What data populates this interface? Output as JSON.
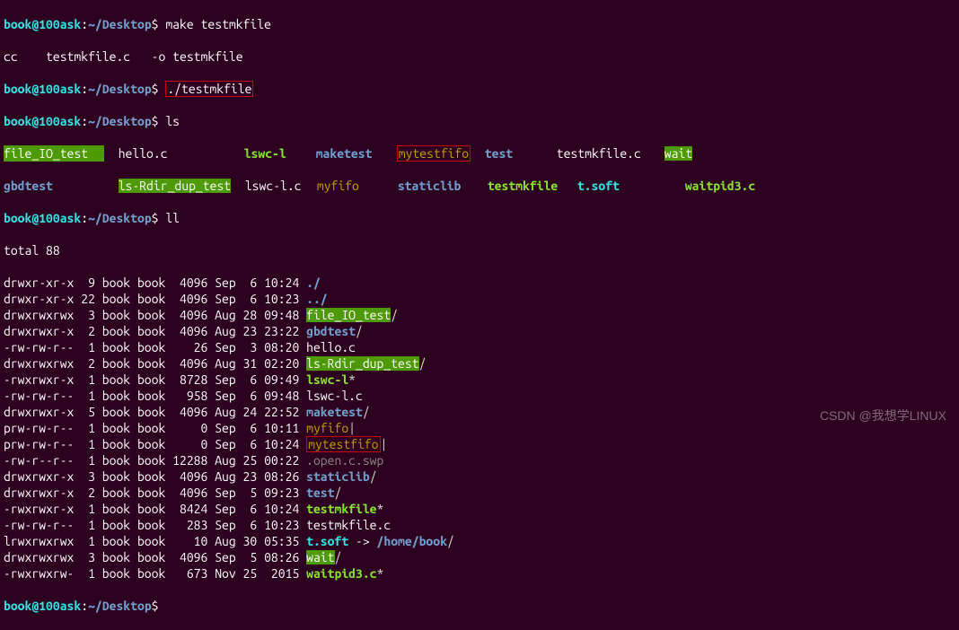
{
  "prompt_user_host": "book@100ask",
  "prompt_sep": ":",
  "prompt_path": "~/Desktop",
  "prompt_dollar": "$ ",
  "lines": {
    "l0_cmd": "make testmkfile",
    "l1": "cc    testmkfile.c   -o testmkfile",
    "l2_cmd": "./testmkfile",
    "l3_cmd": "ls",
    "l5_cmd": "ll",
    "total": "total 88"
  },
  "ls_cols": {
    "c0a": "file_IO_test",
    "c0b": "gbdtest",
    "c1a": "hello.c",
    "c1b": "ls-Rdir_dup_test",
    "c2a": "lswc-l",
    "c2b": "lswc-l.c",
    "c3a": "maketest",
    "c3b": "myfifo",
    "c4a": "mytestfifo",
    "c4b": "staticlib",
    "c5a": "test",
    "c5b": "testmkfile",
    "c6a": "testmkfile.c",
    "c6b": "t.soft",
    "c7a": "wait",
    "c7b": "waitpid3.c"
  },
  "ll": [
    {
      "perm": "drwxr-xr-x",
      "ln": " 9",
      "own": "book book",
      "size": " 4096",
      "date": "Sep  6 10:24",
      "name": "./",
      "cls": "dir"
    },
    {
      "perm": "drwxr-xr-x",
      "ln": "22",
      "own": "book book",
      "size": " 4096",
      "date": "Sep  6 10:23",
      "name": "../",
      "cls": "dir"
    },
    {
      "perm": "drwxrwxrwx",
      "ln": " 3",
      "own": "book book",
      "size": " 4096",
      "date": "Aug 28 09:48",
      "name": "file_IO_test",
      "cls": "hl",
      "suffix": "/"
    },
    {
      "perm": "drwxrwxr-x",
      "ln": " 2",
      "own": "book book",
      "size": " 4096",
      "date": "Aug 23 23:22",
      "name": "gbdtest",
      "cls": "dir",
      "suffix": "/"
    },
    {
      "perm": "-rw-rw-r--",
      "ln": " 1",
      "own": "book book",
      "size": "   26",
      "date": "Sep  3 08:20",
      "name": "hello.c",
      "cls": "white"
    },
    {
      "perm": "drwxrwxrwx",
      "ln": " 2",
      "own": "book book",
      "size": " 4096",
      "date": "Aug 31 02:20",
      "name": "ls-Rdir_dup_test",
      "cls": "hl",
      "suffix": "/"
    },
    {
      "perm": "-rwxrwxr-x",
      "ln": " 1",
      "own": "book book",
      "size": " 8728",
      "date": "Sep  6 09:49",
      "name": "lswc-l",
      "cls": "exe",
      "suffix": "*"
    },
    {
      "perm": "-rw-rw-r--",
      "ln": " 1",
      "own": "book book",
      "size": "  958",
      "date": "Sep  6 09:48",
      "name": "lswc-l.c",
      "cls": "white"
    },
    {
      "perm": "drwxrwxr-x",
      "ln": " 5",
      "own": "book book",
      "size": " 4096",
      "date": "Aug 24 22:52",
      "name": "maketest",
      "cls": "dir",
      "suffix": "/"
    },
    {
      "perm": "prw-rw-r--",
      "ln": " 1",
      "own": "book book",
      "size": "    0",
      "date": "Sep  6 10:11",
      "name": "myfifo",
      "cls": "fifo",
      "suffix": "|"
    },
    {
      "perm": "prw-rw-r--",
      "ln": " 1",
      "own": "book book",
      "size": "    0",
      "date": "Sep  6 10:24",
      "name": "mytestfifo",
      "cls": "fifo",
      "suffix": "|",
      "boxed": true
    },
    {
      "perm": "-rw-r--r--",
      "ln": " 1",
      "own": "book book",
      "size": "12288",
      "date": "Aug 25 00:22",
      "name": ".open.c.swp",
      "cls": "muted"
    },
    {
      "perm": "drwxrwxr-x",
      "ln": " 3",
      "own": "book book",
      "size": " 4096",
      "date": "Aug 23 08:26",
      "name": "staticlib",
      "cls": "dir",
      "suffix": "/"
    },
    {
      "perm": "drwxrwxr-x",
      "ln": " 2",
      "own": "book book",
      "size": " 4096",
      "date": "Sep  5 09:23",
      "name": "test",
      "cls": "dir",
      "suffix": "/"
    },
    {
      "perm": "-rwxrwxr-x",
      "ln": " 1",
      "own": "book book",
      "size": " 8424",
      "date": "Sep  6 10:24",
      "name": "testmkfile",
      "cls": "exe",
      "suffix": "*"
    },
    {
      "perm": "-rw-rw-r--",
      "ln": " 1",
      "own": "book book",
      "size": "  283",
      "date": "Sep  6 10:23",
      "name": "testmkfile.c",
      "cls": "white"
    },
    {
      "perm": "lrwxrwxrwx",
      "ln": " 1",
      "own": "book book",
      "size": "   10",
      "date": "Aug 30 05:35",
      "name": "t.soft",
      "cls": "link",
      "arrow": " -> ",
      "target": "/home/book",
      "tcls": "dir",
      "tsuffix": "/"
    },
    {
      "perm": "drwxrwxrwx",
      "ln": " 3",
      "own": "book book",
      "size": " 4096",
      "date": "Sep  5 08:26",
      "name": "wait",
      "cls": "hl",
      "suffix": "/"
    },
    {
      "perm": "-rwxrwxrw-",
      "ln": " 1",
      "own": "book book",
      "size": "  673",
      "date": "Nov 25  2015",
      "name": "waitpid3.c",
      "cls": "exe",
      "suffix": "*"
    }
  ],
  "watermark": "CSDN @我想学LINUX"
}
